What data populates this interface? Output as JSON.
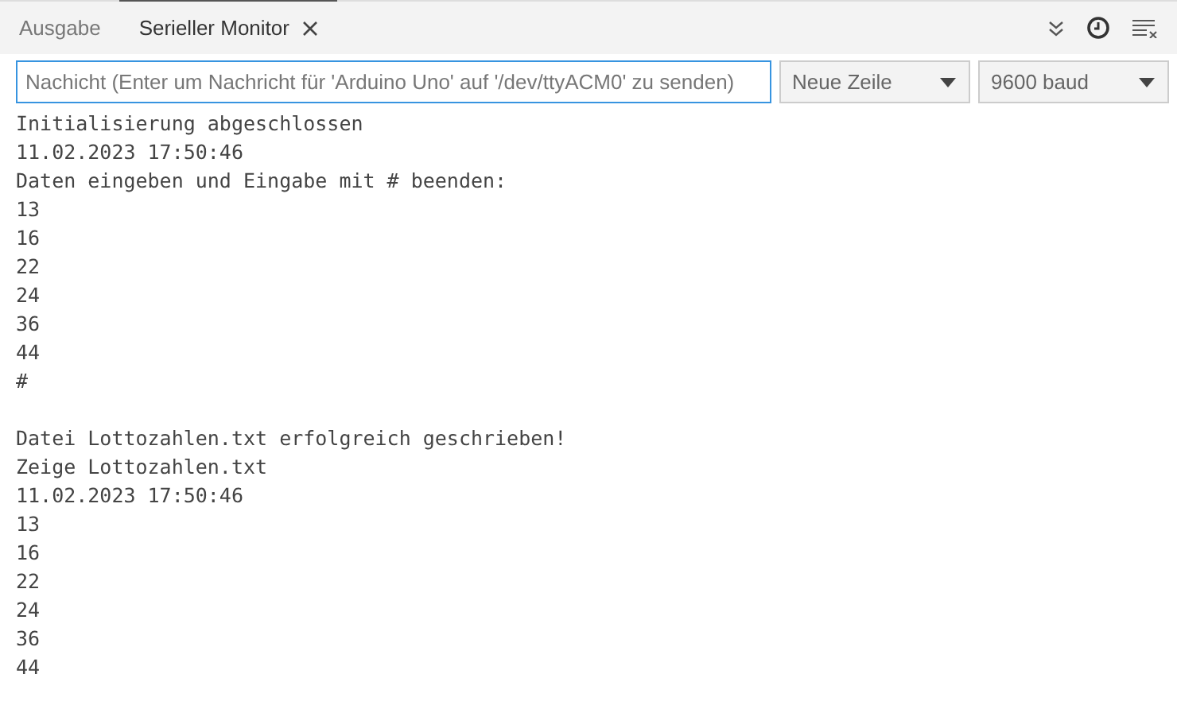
{
  "tabs": [
    {
      "label": "Ausgabe",
      "selected": false,
      "closable": false
    },
    {
      "label": "Serieller Monitor",
      "selected": true,
      "closable": true
    }
  ],
  "message_field": {
    "placeholder": "Nachicht (Enter um Nachricht für 'Arduino Uno' auf '/dev/ttyACM0' zu senden)"
  },
  "line_ending": {
    "value": "Neue Zeile"
  },
  "baud_rate": {
    "value": "9600 baud"
  },
  "output": [
    {
      "kind": "text",
      "text": "Initialisierung abgeschlossen"
    },
    {
      "kind": "text",
      "text": "11.02.2023 17:50:46"
    },
    {
      "kind": "text",
      "text": "Daten eingeben und Eingabe mit # beenden:"
    },
    {
      "kind": "text",
      "text": "13"
    },
    {
      "kind": "text",
      "text": "16"
    },
    {
      "kind": "text",
      "text": "22"
    },
    {
      "kind": "text",
      "text": "24"
    },
    {
      "kind": "text",
      "text": "36"
    },
    {
      "kind": "text",
      "text": "44"
    },
    {
      "kind": "text",
      "text": "#"
    },
    {
      "kind": "blank"
    },
    {
      "kind": "text",
      "text": "Datei Lottozahlen.txt erfolgreich geschrieben!"
    },
    {
      "kind": "text",
      "text": "Zeige Lottozahlen.txt"
    },
    {
      "kind": "text",
      "text": "11.02.2023 17:50:46"
    },
    {
      "kind": "text",
      "text": "13"
    },
    {
      "kind": "text",
      "text": "16"
    },
    {
      "kind": "text",
      "text": "22"
    },
    {
      "kind": "text",
      "text": "24"
    },
    {
      "kind": "text",
      "text": "36"
    },
    {
      "kind": "text",
      "text": "44"
    }
  ]
}
